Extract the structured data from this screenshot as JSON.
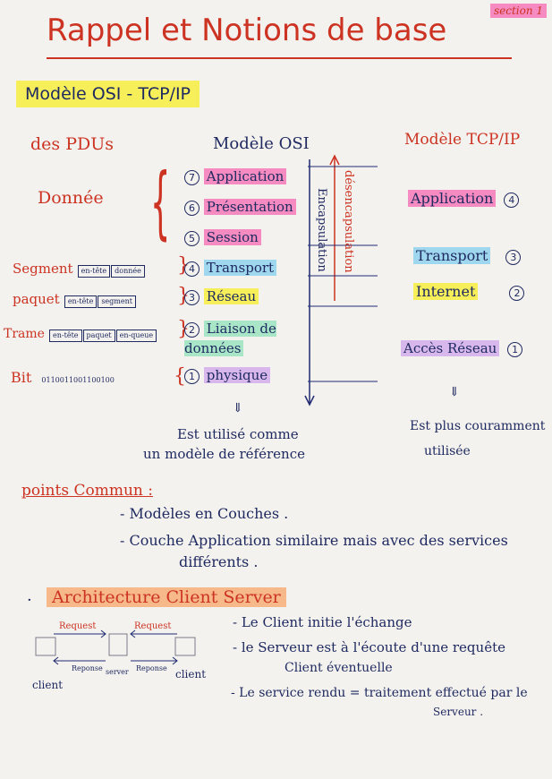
{
  "section_tag": "section 1",
  "title": "Rappel et Notions de base",
  "subtitle": "Modèle OSI - TCP/IP",
  "headers": {
    "pdus": "des PDUs",
    "osi": "Modèle OSI",
    "tcpip": "Modèle TCP/IP"
  },
  "pdu": {
    "donnee": "Donnée",
    "segment": "Segment",
    "segment_boxes": [
      "en-tête",
      "donnée"
    ],
    "paquet": "paquet",
    "paquet_boxes": [
      "en-tête",
      "segment"
    ],
    "trame": "Trame",
    "trame_boxes": [
      "en-tête",
      "paquet",
      "en-queue"
    ],
    "bit": "Bit",
    "bit_value": "0110011001100100"
  },
  "osi_layers": [
    {
      "num": "7",
      "name": "Application"
    },
    {
      "num": "6",
      "name": "Présentation"
    },
    {
      "num": "5",
      "name": "Session"
    },
    {
      "num": "4",
      "name": "Transport"
    },
    {
      "num": "3",
      "name": "Réseau"
    },
    {
      "num": "2",
      "name": "Liaison de données"
    },
    {
      "num": "1",
      "name": "physique"
    }
  ],
  "arrows": {
    "decap": "désencapsulation",
    "encap": "Encapsulation"
  },
  "tcpip_layers": [
    {
      "num": "4",
      "name": "Application"
    },
    {
      "num": "3",
      "name": "Transport"
    },
    {
      "num": "2",
      "name": "Internet"
    },
    {
      "num": "1",
      "name": "Accès Réseau"
    }
  ],
  "osi_note": [
    "Est utilisé comme",
    "un modèle de référence"
  ],
  "tcpip_note": [
    "Est plus couramment",
    "utilisée"
  ],
  "points_title": "points Commun :",
  "points": [
    "- Modèles en Couches .",
    "- Couche Application similaire mais avec des services",
    "différents ."
  ],
  "arch_title": "Architecture Client Server",
  "diagram": {
    "request1": "Request",
    "request2": "Request",
    "reponse1": "Reponse",
    "serveur": "server",
    "reponse2": "Reponse",
    "client1": "client",
    "client2": "client"
  },
  "arch_points": [
    "- Le Client initie l'échange",
    "- le Serveur est à l'écoute d'une requête",
    "Client éventuelle",
    "- Le service rendu = traitement effectué par le",
    "Serveur ."
  ]
}
